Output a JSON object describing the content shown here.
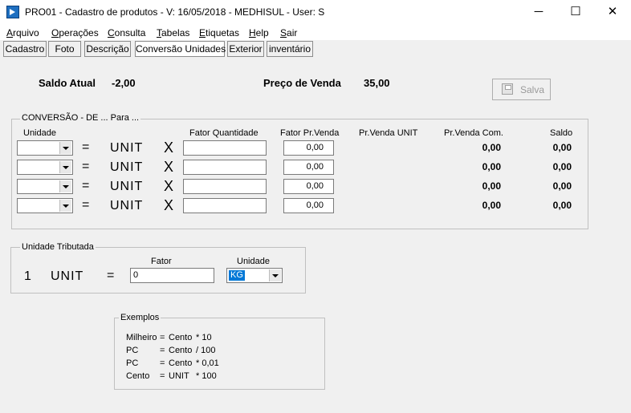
{
  "window": {
    "title": "PRO01 - Cadastro de produtos - V: 16/05/2018 - MEDHISUL - User: S",
    "minimize": "─",
    "maximize": "☐",
    "close": "✕"
  },
  "menu": [
    {
      "first": "A",
      "rest": "rquivo"
    },
    {
      "first": "O",
      "rest": "perações"
    },
    {
      "first": "C",
      "rest": "onsulta"
    },
    {
      "first": "T",
      "rest": "abelas"
    },
    {
      "first": "E",
      "rest": "tiquetas"
    },
    {
      "first": "H",
      "rest": "elp"
    },
    {
      "first": "S",
      "rest": "air"
    }
  ],
  "tabs": [
    "Cadastro",
    "Foto",
    "Descrição",
    "Conversão Unidades",
    "Exterior",
    "inventário"
  ],
  "summary": {
    "saldo_label": "Saldo Atual",
    "saldo_value": "-2,00",
    "preco_label": "Preço de Venda",
    "preco_value": "35,00",
    "save_label": "Salva"
  },
  "conversion": {
    "group_title": "CONVERSÃO - DE ... Para ...",
    "headers": {
      "unidade": "Unidade",
      "fator_quantidade": "Fator Quantidade",
      "fator_pr_venda": "Fator Pr.Venda",
      "pr_venda_unit": "Pr.Venda UNIT",
      "pr_venda_com": "Pr.Venda Com.",
      "saldo": "Saldo"
    },
    "rows": [
      {
        "unidade": "",
        "equals": "=",
        "unit": "UNIT",
        "times": "X",
        "fator_quantidade": "",
        "fator_pr_venda": "0,00",
        "pr_venda_com": "0,00",
        "saldo": "0,00"
      },
      {
        "unidade": "",
        "equals": "=",
        "unit": "UNIT",
        "times": "X",
        "fator_quantidade": "",
        "fator_pr_venda": "0,00",
        "pr_venda_com": "0,00",
        "saldo": "0,00"
      },
      {
        "unidade": "",
        "equals": "=",
        "unit": "UNIT",
        "times": "X",
        "fator_quantidade": "",
        "fator_pr_venda": "0,00",
        "pr_venda_com": "0,00",
        "saldo": "0,00"
      },
      {
        "unidade": "",
        "equals": "=",
        "unit": "UNIT",
        "times": "X",
        "fator_quantidade": "",
        "fator_pr_venda": "0,00",
        "pr_venda_com": "0,00",
        "saldo": "0,00"
      }
    ]
  },
  "tributada": {
    "group_title": "Unidade Tributada",
    "qty": "1",
    "unit": "UNIT",
    "equals": "=",
    "fator_label": "Fator",
    "fator_value": "0",
    "unidade_label": "Unidade",
    "unidade_value": "KG"
  },
  "exemplos": {
    "group_title": "Exemplos",
    "lines": [
      {
        "a": "Milheiro",
        "eq": "=",
        "b": "Cento",
        "op": "* 10"
      },
      {
        "a": "PC",
        "eq": "=",
        "b": "Cento",
        "op": "/ 100"
      },
      {
        "a": "PC",
        "eq": "=",
        "b": "Cento",
        "op": "* 0,01"
      },
      {
        "a": "Cento",
        "eq": "=",
        "b": "UNIT",
        "op": "* 100"
      }
    ]
  },
  "colors": {
    "selection": "#0078d7",
    "window": "#f0f0f0"
  }
}
